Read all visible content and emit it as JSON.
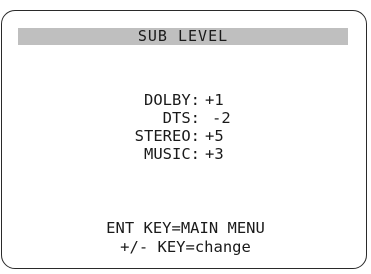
{
  "screen": {
    "title": "SUB LEVEL",
    "levels": [
      {
        "label": "DOLBY:",
        "value": "+1"
      },
      {
        "label": "DTS:",
        "value": "-2"
      },
      {
        "label": "STEREO:",
        "value": "+5"
      },
      {
        "label": "MUSIC:",
        "value": "+3"
      }
    ],
    "footer": {
      "line1": "ENT KEY=MAIN MENU",
      "line2": "+/- KEY=change"
    }
  },
  "colors": {
    "title_bar": "#bfbfbf",
    "frame": "#2a2a2a",
    "text": "#1a1a1a"
  }
}
